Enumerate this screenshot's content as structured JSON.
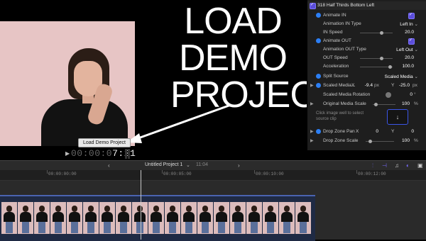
{
  "viewer": {
    "headline_lines": [
      "LOAD",
      "DEMO",
      "PROJECT"
    ],
    "tooltip": "Load Demo Project",
    "timecode_dim": "00:00:0",
    "timecode_bright": "7:21"
  },
  "inspector": {
    "title": "318 Half Thirds Bottom Left",
    "rows": {
      "animate_in": "Animate IN",
      "animation_in_type_label": "Animation  IN Type",
      "animation_in_type_value": "Left In",
      "in_speed_label": "IN Speed",
      "in_speed_value": "20.0",
      "animate_out": "Animate OUT",
      "animation_out_type_label": "Animation OUT Type",
      "animation_out_type_value": "Left Out",
      "out_speed_label": "OUT Speed",
      "out_speed_value": "20.0",
      "acceleration_label": "Acceleration",
      "acceleration_value": "100.0",
      "split_source_label": "Split Source",
      "split_source_value": "Scaled Media",
      "scaled_media_label": "Scaled Media...",
      "x_label": "X",
      "x_value": "-9.4",
      "x_unit": "px",
      "y_label": "Y",
      "y_value": "-25.0",
      "y_unit": "px",
      "rotation_label": "Scaled Media Rotation",
      "rotation_value": "0",
      "rotation_unit": "°",
      "orig_scale_label": "Original Media Scale",
      "orig_scale_value": "100",
      "orig_scale_unit": "%",
      "well_hint": "Click image well to select source clip",
      "drop_pan_label": "Drop Zone Pan",
      "drop_pan_x_label": "X",
      "drop_pan_x_value": "0",
      "drop_pan_y_label": "Y",
      "drop_pan_y_value": "0",
      "drop_scale_label": "Drop Zone Scale",
      "drop_scale_value": "100",
      "drop_scale_unit": "%"
    }
  },
  "timeline": {
    "project_title": "Untitled Project 1",
    "duration": "11:04",
    "ruler_labels": [
      "00:00:00:00",
      "00:00:05:00",
      "00:00:10:00",
      "00:00:12:00"
    ]
  },
  "colors": {
    "accent_purple": "#5b4dd9",
    "keyframe_blue": "#2c7ff5",
    "clip_bar": "#4a63b0"
  }
}
